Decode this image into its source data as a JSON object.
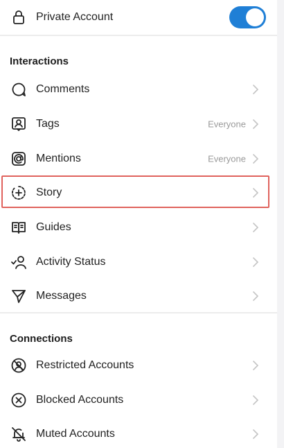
{
  "private_account": {
    "label": "Private Account",
    "enabled": true
  },
  "interactions": {
    "title": "Interactions",
    "items": [
      {
        "label": "Comments",
        "icon": "comment-icon",
        "value": ""
      },
      {
        "label": "Tags",
        "icon": "tag-person-icon",
        "value": "Everyone"
      },
      {
        "label": "Mentions",
        "icon": "at-sign-icon",
        "value": "Everyone"
      },
      {
        "label": "Story",
        "icon": "story-add-icon",
        "value": ""
      },
      {
        "label": "Guides",
        "icon": "guides-icon",
        "value": ""
      },
      {
        "label": "Activity Status",
        "icon": "activity-status-icon",
        "value": ""
      },
      {
        "label": "Messages",
        "icon": "send-icon",
        "value": ""
      }
    ]
  },
  "connections": {
    "title": "Connections",
    "items": [
      {
        "label": "Restricted Accounts",
        "icon": "restricted-icon"
      },
      {
        "label": "Blocked Accounts",
        "icon": "blocked-icon"
      },
      {
        "label": "Muted Accounts",
        "icon": "muted-icon"
      }
    ]
  },
  "colors": {
    "toggle_on": "#1f7fd6",
    "highlight": "#e0625c",
    "secondary_text": "#9a9a9a"
  }
}
